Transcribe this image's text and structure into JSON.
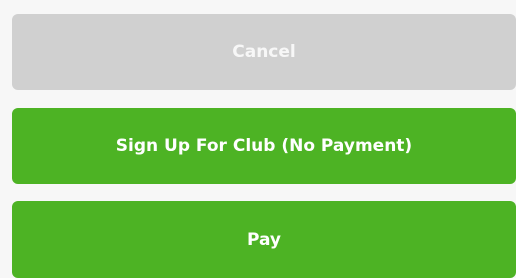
{
  "actions": {
    "cancel_label": "Cancel",
    "signup_label": "Sign Up For Club (No Payment)",
    "pay_label": "Pay"
  },
  "colors": {
    "background": "#f7f7f7",
    "cancel_bg": "#d0d0d0",
    "primary_green": "#4db324",
    "text_on_primary": "#ffffff"
  }
}
